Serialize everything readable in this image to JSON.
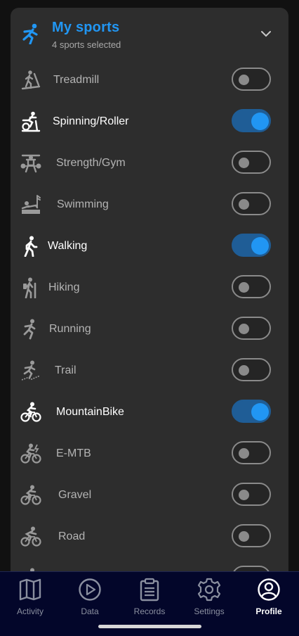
{
  "colors": {
    "accent": "#2196f3",
    "card_background": "#2d2d2d",
    "nav_background": "#03062a",
    "toggle_on_track": "#1f5d96"
  },
  "header": {
    "title": "My sports",
    "subtitle": "4 sports selected",
    "icon": "running-person-icon",
    "expand_icon": "chevron-down-icon"
  },
  "sports": [
    {
      "label": "Treadmill",
      "icon": "treadmill-icon",
      "enabled": false
    },
    {
      "label": "Spinning/Roller",
      "icon": "spinning-bike-icon",
      "enabled": true
    },
    {
      "label": "Strength/Gym",
      "icon": "weightlifting-icon",
      "enabled": false
    },
    {
      "label": "Swimming",
      "icon": "swimming-icon",
      "enabled": false
    },
    {
      "label": "Walking",
      "icon": "walking-icon",
      "enabled": true
    },
    {
      "label": "Hiking",
      "icon": "hiking-icon",
      "enabled": false
    },
    {
      "label": "Running",
      "icon": "running-icon",
      "enabled": false
    },
    {
      "label": "Trail",
      "icon": "trail-running-icon",
      "enabled": false
    },
    {
      "label": "MountainBike",
      "icon": "mountain-bike-icon",
      "enabled": true
    },
    {
      "label": "E-MTB",
      "icon": "e-mtb-icon",
      "enabled": false
    },
    {
      "label": "Gravel",
      "icon": "gravel-bike-icon",
      "enabled": false
    },
    {
      "label": "Road",
      "icon": "road-bike-icon",
      "enabled": false
    }
  ],
  "nav": {
    "items": [
      {
        "label": "Activity",
        "icon": "map-icon",
        "active": false
      },
      {
        "label": "Data",
        "icon": "play-circle-icon",
        "active": false
      },
      {
        "label": "Records",
        "icon": "clipboard-icon",
        "active": false
      },
      {
        "label": "Settings",
        "icon": "gear-icon",
        "active": false
      },
      {
        "label": "Profile",
        "icon": "user-circle-icon",
        "active": true
      }
    ]
  }
}
